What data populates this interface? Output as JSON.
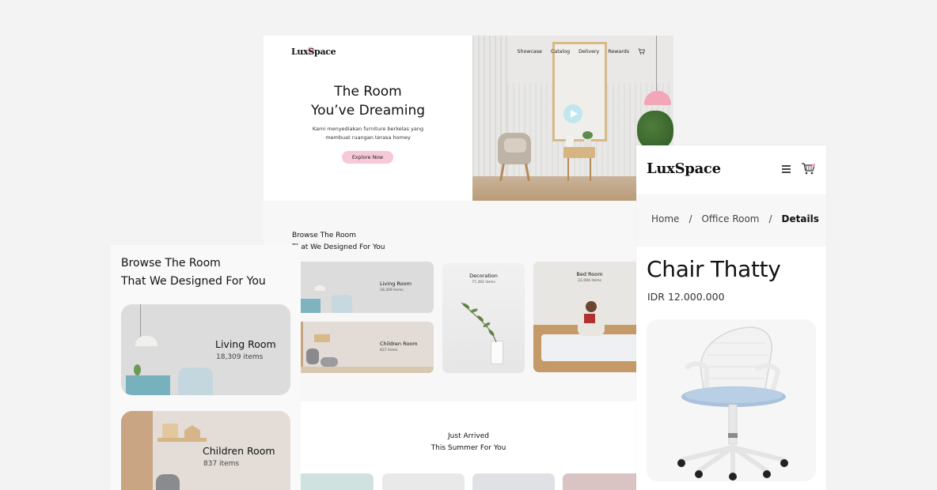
{
  "brand": {
    "name_before": "Lux",
    "name_s": "S",
    "name_after": "pace",
    "accent": "#f6c4d3"
  },
  "desktop": {
    "nav": {
      "links": [
        "Showcase",
        "Catalog",
        "Delivery",
        "Rewards"
      ],
      "cart_icon": "cart-icon"
    },
    "hero": {
      "title_line1": "The Room",
      "title_line2": "You’ve Dreaming",
      "subtitle_line1": "Kami menyediakan furniture berkelas yang",
      "subtitle_line2": "membuat ruangan terasa homey",
      "cta": "Explore Now",
      "play_icon": "play-icon"
    },
    "browse": {
      "title_line1": "Browse The Room",
      "title_line2": "That We Designed For You",
      "cards": [
        {
          "name": "Living Room",
          "count": "18,309 items"
        },
        {
          "name": "Children Room",
          "count": "837 items"
        },
        {
          "name": "Decoration",
          "count": "77,392 items"
        },
        {
          "name": "Bed Room",
          "count": "22,094 items"
        }
      ]
    },
    "arrived": {
      "title_line1": "Just Arrived",
      "title_line2": "This Summer For You"
    }
  },
  "mobile_left": {
    "title_line1": "Browse The Room",
    "title_line2": "That We Designed For You",
    "cards": [
      {
        "name": "Living Room",
        "count": "18,309 items"
      },
      {
        "name": "Children Room",
        "count": "837 items"
      }
    ]
  },
  "mobile_right": {
    "menu_icon": "hamburger-icon",
    "cart_icon": "cart-icon",
    "breadcrumb": [
      "Home",
      "Office Room",
      "Details"
    ],
    "breadcrumb_sep": "/",
    "product": {
      "name": "Chair Thatty",
      "price": "IDR 12.000.000"
    }
  }
}
